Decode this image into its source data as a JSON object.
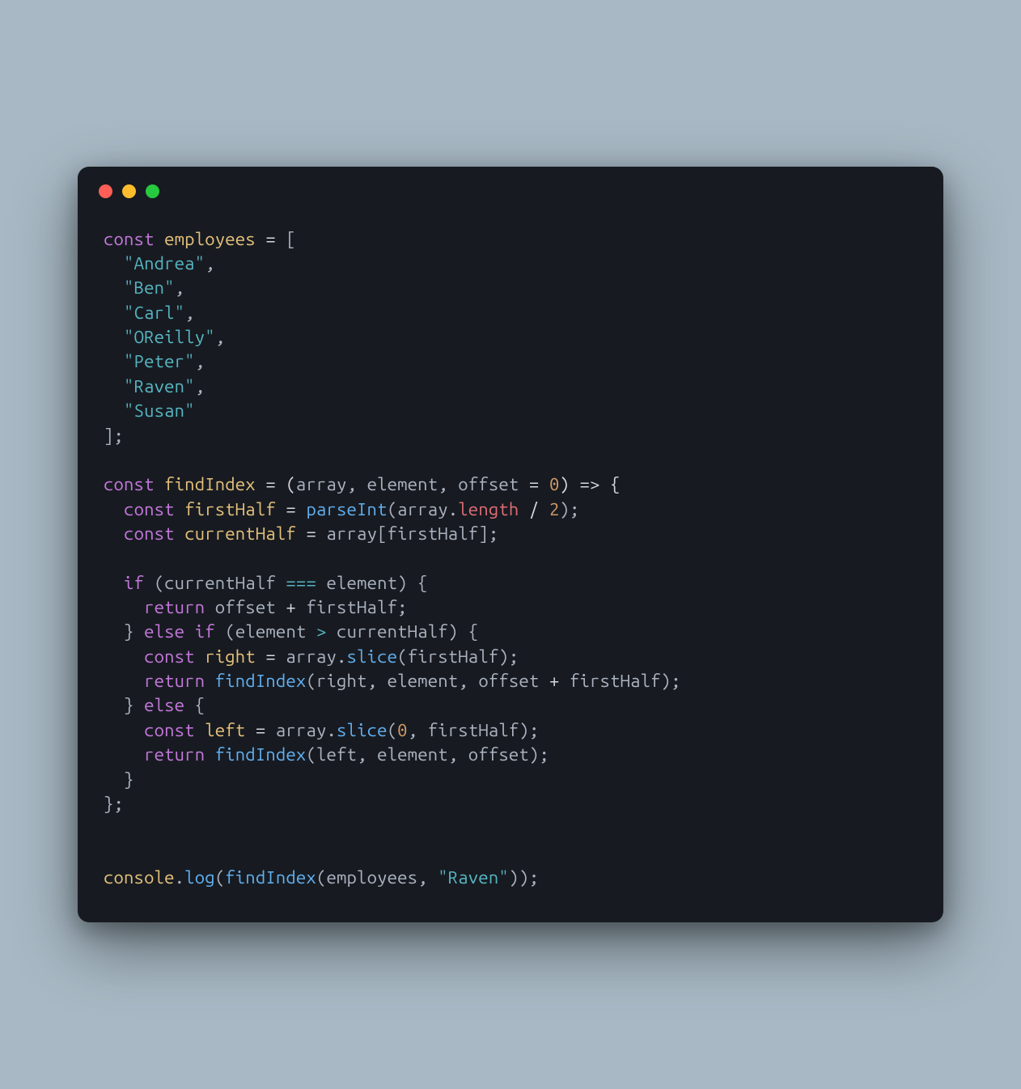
{
  "window": {
    "traffic_lights": {
      "close_color": "#ff5f56",
      "minimize_color": "#ffbd2e",
      "zoom_color": "#27c93f"
    }
  },
  "code": {
    "const_kw": "const",
    "employees_decl": "employees",
    "eq": " = ",
    "lbracket": "[",
    "employees": {
      "0": "\"Andrea\"",
      "1": "\"Ben\"",
      "2": "\"Carl\"",
      "3": "\"OReilly\"",
      "4": "\"Peter\"",
      "5": "\"Raven\"",
      "6": "\"Susan\""
    },
    "rbracket_semi": "];",
    "findIndex_decl": "findIndex",
    "arrow_open": " = (",
    "param_array": "array",
    "param_element": "element",
    "param_offset": "offset",
    "default_zero": "0",
    "arrow_suffix": ") => {",
    "firstHalf_decl": "firstHalf",
    "parseInt_fn": "parseInt",
    "length_prop": "length",
    "div2": " / ",
    "two": "2",
    "currentHalf_decl": "currentHalf",
    "array_ref": "array",
    "firstHalf_ref": "firstHalf",
    "if_kw": "if",
    "currentHalf_ref": "currentHalf",
    "triple_eq": " === ",
    "element_ref": "element",
    "return_kw": "return",
    "offset_ref": "offset",
    "plus": " + ",
    "else_kw": "else",
    "gt": " > ",
    "right_decl": "right",
    "slice_fn": "slice",
    "left_decl": "left",
    "zero": "0",
    "console_obj": "console",
    "log_fn": "log",
    "findIndex_ref": "findIndex",
    "employees_ref": "employees",
    "raven_str": "\"Raven\"",
    "comma": ", ",
    "comma_trail": ",",
    "semi": ";",
    "lparen": "(",
    "rparen": ")",
    "lbrace": "{",
    "rbrace": "}",
    "dot": ".",
    "lbracket_idx": "[",
    "rbracket_idx": "]",
    "rparen_rparen_semi": "));",
    "rparen_semi": ");",
    "rparen_space_lbrace": ") {"
  }
}
